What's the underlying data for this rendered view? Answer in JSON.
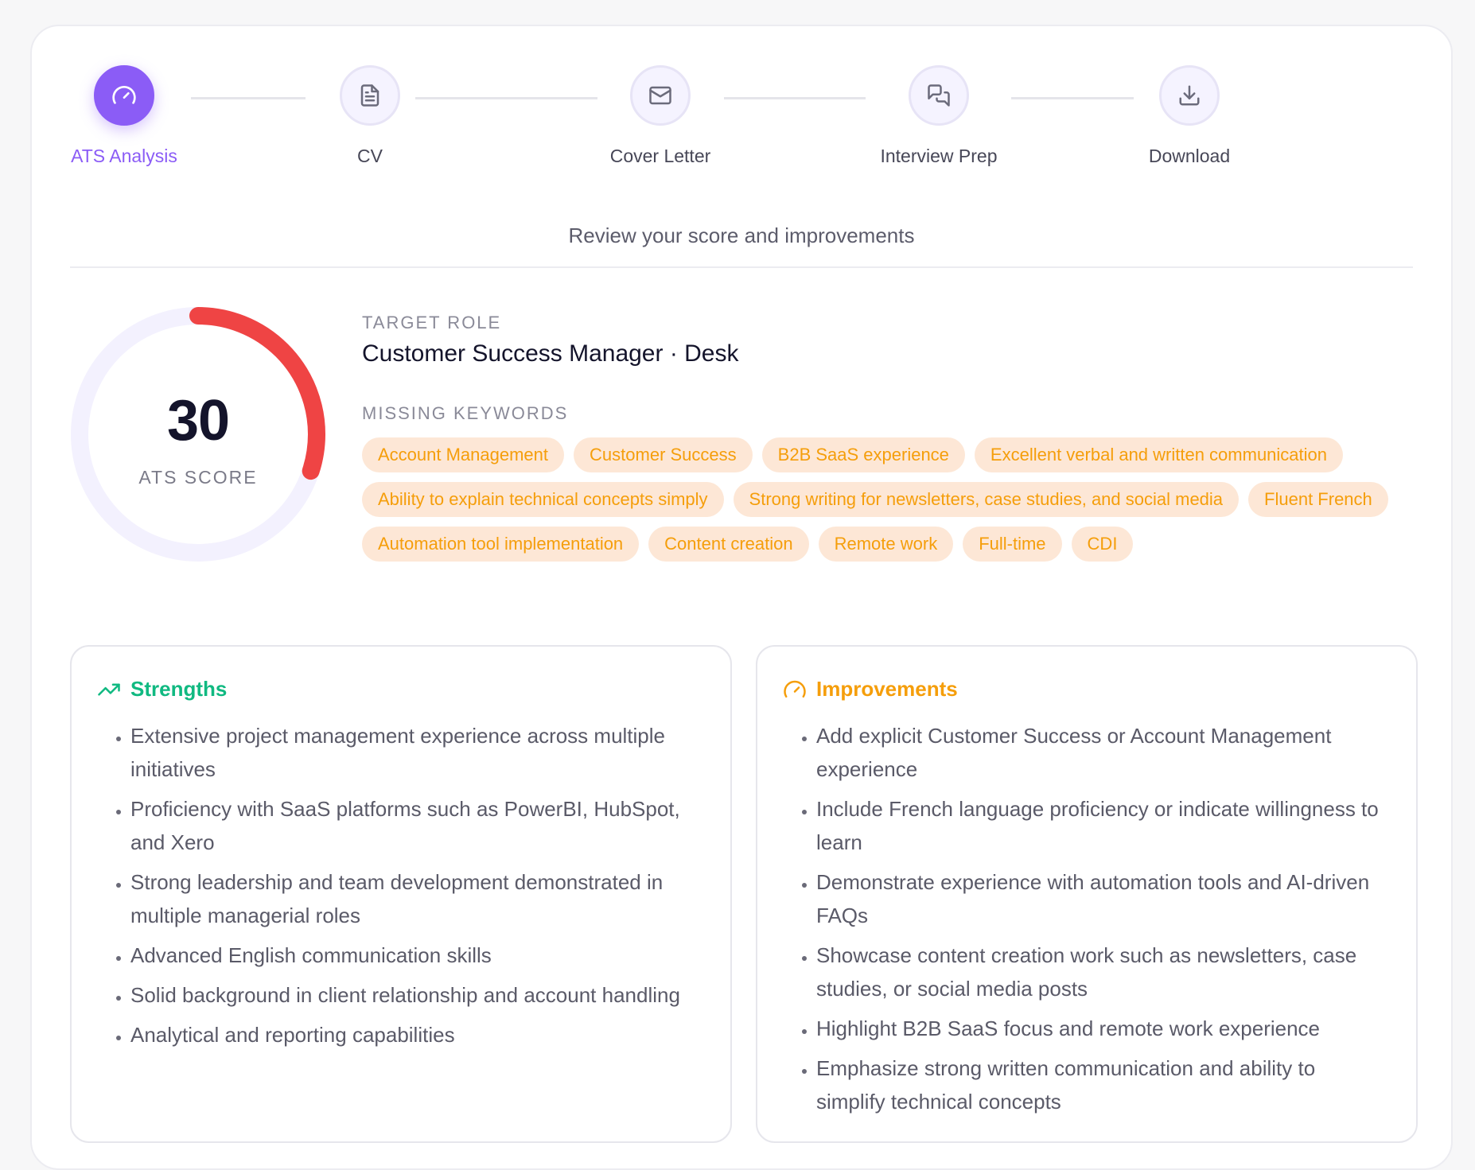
{
  "stepper": {
    "steps": [
      {
        "label": "ATS Analysis",
        "icon": "gauge-icon",
        "active": true
      },
      {
        "label": "CV",
        "icon": "document-icon",
        "active": false
      },
      {
        "label": "Cover Letter",
        "icon": "mail-icon",
        "active": false
      },
      {
        "label": "Interview Prep",
        "icon": "chat-icon",
        "active": false
      },
      {
        "label": "Download",
        "icon": "download-icon",
        "active": false
      }
    ],
    "subtitle": "Review your score and improvements"
  },
  "score": {
    "value": "30",
    "label": "ATS SCORE",
    "fraction": 0.3,
    "color": "#ef4444",
    "track_color": "#f3f1fe"
  },
  "target_role": {
    "label": "TARGET ROLE",
    "value": "Customer Success Manager · Desk"
  },
  "missing_keywords": {
    "label": "MISSING KEYWORDS",
    "items": [
      "Account Management",
      "Customer Success",
      "B2B SaaS experience",
      "Excellent verbal and written communication",
      "Ability to explain technical concepts simply",
      "Strong writing for newsletters, case studies, and social media",
      "Fluent French",
      "Automation tool implementation",
      "Content creation",
      "Remote work",
      "Full-time",
      "CDI"
    ]
  },
  "strengths": {
    "title": "Strengths",
    "icon": "trending-up-icon",
    "color": "#10b981",
    "items": [
      "Extensive project management experience across multiple initiatives",
      "Proficiency with SaaS platforms such as PowerBI, HubSpot, and Xero",
      "Strong leadership and team development demonstrated in multiple managerial roles",
      "Advanced English communication skills",
      "Solid background in client relationship and account handling",
      "Analytical and reporting capabilities"
    ]
  },
  "improvements": {
    "title": "Improvements",
    "icon": "gauge-icon",
    "color": "#f59e0b",
    "items": [
      "Add explicit Customer Success or Account Management experience",
      "Include French language proficiency or indicate willingness to learn",
      "Demonstrate experience with automation tools and AI-driven FAQs",
      "Showcase content creation work such as newsletters, case studies, or social media posts",
      "Highlight B2B SaaS focus and remote work experience",
      "Emphasize strong written communication and ability to simplify technical concepts"
    ]
  },
  "colors": {
    "accent": "#8b5cf6",
    "chip_bg": "#fde7d6",
    "chip_text": "#f59e0b"
  }
}
